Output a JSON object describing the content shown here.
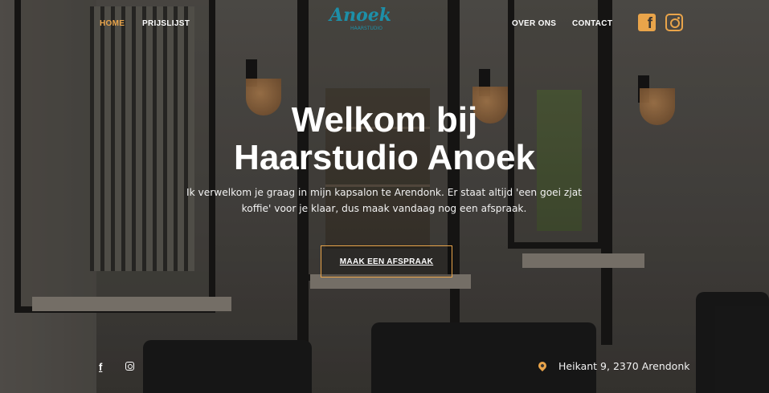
{
  "nav": {
    "left": [
      {
        "label": "HOME",
        "active": true
      },
      {
        "label": "PRIJSLIJST",
        "active": false
      }
    ],
    "right": [
      {
        "label": "OVER ONS"
      },
      {
        "label": "CONTACT"
      }
    ],
    "logo": {
      "text": "Anoek",
      "subtitle": "HAARSTUDIO"
    }
  },
  "social": {
    "header_icons": [
      "facebook-icon",
      "instagram-icon"
    ],
    "footer_icons": [
      "facebook-icon",
      "instagram-icon"
    ]
  },
  "hero": {
    "title_line1": "Welkom bij",
    "title_line2": "Haarstudio Anoek",
    "text_line1": "Ik verwelkom je graag in mijn kapsalon te Arendonk. Er staat altijd 'een goei zjat",
    "text_line2": "koffie' voor je klaar, dus maak vandaag nog een afspraak.",
    "cta_label": "MAAK EEN AFSPRAAK"
  },
  "footer": {
    "facebook_glyph": "f",
    "address_icon": "map-pin-icon",
    "address": "Heikant 9, 2370 Arendonk"
  },
  "colors": {
    "accent": "#e9a44a",
    "logo": "#1d8fa8",
    "text": "#ffffff"
  }
}
